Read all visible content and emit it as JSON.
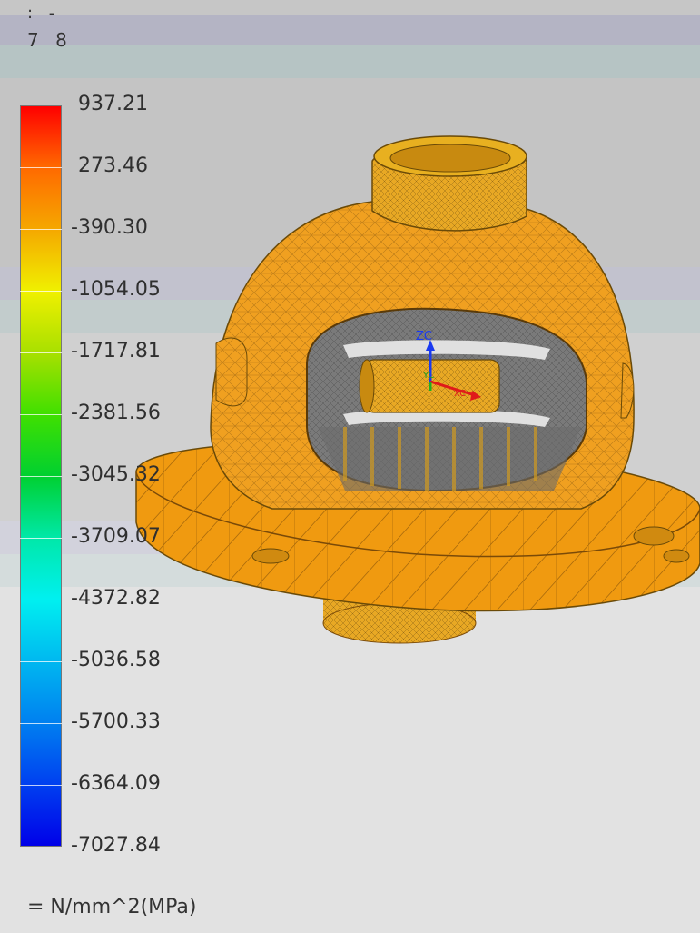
{
  "header": {
    "line1": ": -",
    "line2": "7 8"
  },
  "legend": {
    "labels": [
      "937.21",
      "273.46",
      "-390.30",
      "-1054.05",
      "-1717.81",
      "-2381.56",
      "-3045.32",
      "-3709.07",
      "-4372.82",
      "-5036.58",
      "-5700.33",
      "-6364.09",
      "-7027.84"
    ],
    "units": "= N/mm^2(MPa)",
    "colors": [
      "#ff0000",
      "#ff6a00",
      "#f5a800",
      "#f0f000",
      "#a8e000",
      "#40e000",
      "#00d030",
      "#00e8a8",
      "#00f0f0",
      "#00b8f0",
      "#0080f0",
      "#0040f0",
      "#0000e8"
    ]
  },
  "triad": {
    "zc_label": "ZC",
    "yc_label": "YC",
    "xc_label": "XC"
  },
  "colors": {
    "model_fill": "#f0a020",
    "model_mesh": "#8a5a10",
    "interior_mesh": "#6e6e6e",
    "background_top": "#c8c8c8",
    "background_bottom": "#e2e2e2"
  }
}
